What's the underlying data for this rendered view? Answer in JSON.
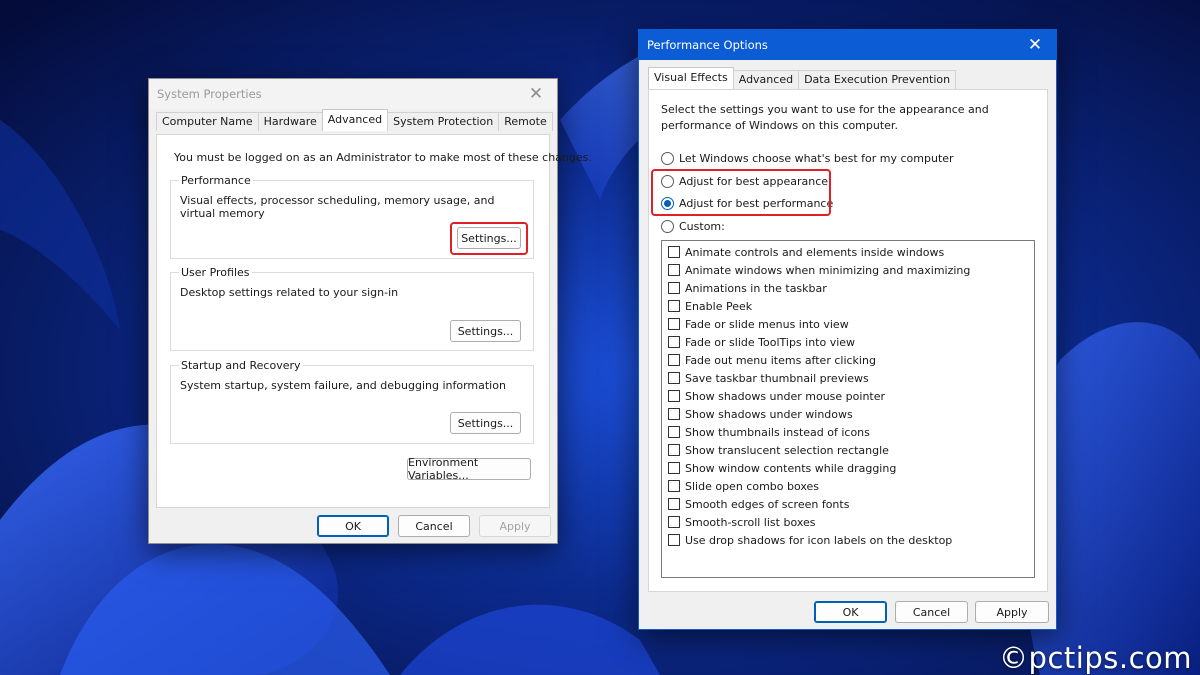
{
  "system_properties": {
    "title": "System Properties",
    "close_glyph": "✕",
    "tabs": [
      {
        "label": "Computer Name",
        "active": false
      },
      {
        "label": "Hardware",
        "active": false
      },
      {
        "label": "Advanced",
        "active": true
      },
      {
        "label": "System Protection",
        "active": false
      },
      {
        "label": "Remote",
        "active": false
      }
    ],
    "admin_note": "You must be logged on as an Administrator to make most of these changes.",
    "performance": {
      "title": "Performance",
      "description": "Visual effects, processor scheduling, memory usage, and virtual memory",
      "button": "Settings...",
      "highlighted": true
    },
    "user_profiles": {
      "title": "User Profiles",
      "description": "Desktop settings related to your sign-in",
      "button": "Settings..."
    },
    "startup_recovery": {
      "title": "Startup and Recovery",
      "description": "System startup, system failure, and debugging information",
      "button": "Settings..."
    },
    "env_button": "Environment Variables...",
    "footer": {
      "ok": "OK",
      "cancel": "Cancel",
      "apply": "Apply",
      "apply_enabled": false
    }
  },
  "performance_options": {
    "title": "Performance Options",
    "close_glyph": "✕",
    "title_bar_color": "#0b5cd5",
    "tabs": [
      {
        "label": "Visual Effects",
        "active": true
      },
      {
        "label": "Advanced",
        "active": false
      },
      {
        "label": "Data Execution Prevention",
        "active": false
      }
    ],
    "intro": "Select the settings you want to use for the appearance and performance of Windows on this computer.",
    "radios": [
      {
        "label": "Let Windows choose what's best for my computer",
        "checked": false
      },
      {
        "label": "Adjust for best appearance",
        "checked": false
      },
      {
        "label": "Adjust for best performance",
        "checked": true
      },
      {
        "label": "Custom:",
        "checked": false
      }
    ],
    "effects": [
      {
        "label": "Animate controls and elements inside windows",
        "checked": false
      },
      {
        "label": "Animate windows when minimizing and maximizing",
        "checked": false
      },
      {
        "label": "Animations in the taskbar",
        "checked": false
      },
      {
        "label": "Enable Peek",
        "checked": false
      },
      {
        "label": "Fade or slide menus into view",
        "checked": false
      },
      {
        "label": "Fade or slide ToolTips into view",
        "checked": false
      },
      {
        "label": "Fade out menu items after clicking",
        "checked": false
      },
      {
        "label": "Save taskbar thumbnail previews",
        "checked": false
      },
      {
        "label": "Show shadows under mouse pointer",
        "checked": false
      },
      {
        "label": "Show shadows under windows",
        "checked": false
      },
      {
        "label": "Show thumbnails instead of icons",
        "checked": false
      },
      {
        "label": "Show translucent selection rectangle",
        "checked": false
      },
      {
        "label": "Show window contents while dragging",
        "checked": false
      },
      {
        "label": "Slide open combo boxes",
        "checked": false
      },
      {
        "label": "Smooth edges of screen fonts",
        "checked": false
      },
      {
        "label": "Smooth-scroll list boxes",
        "checked": false
      },
      {
        "label": "Use drop shadows for icon labels on the desktop",
        "checked": false
      }
    ],
    "footer": {
      "ok": "OK",
      "cancel": "Cancel",
      "apply": "Apply"
    }
  },
  "highlight_color": "#e01f26",
  "watermark": "©pctips.com"
}
